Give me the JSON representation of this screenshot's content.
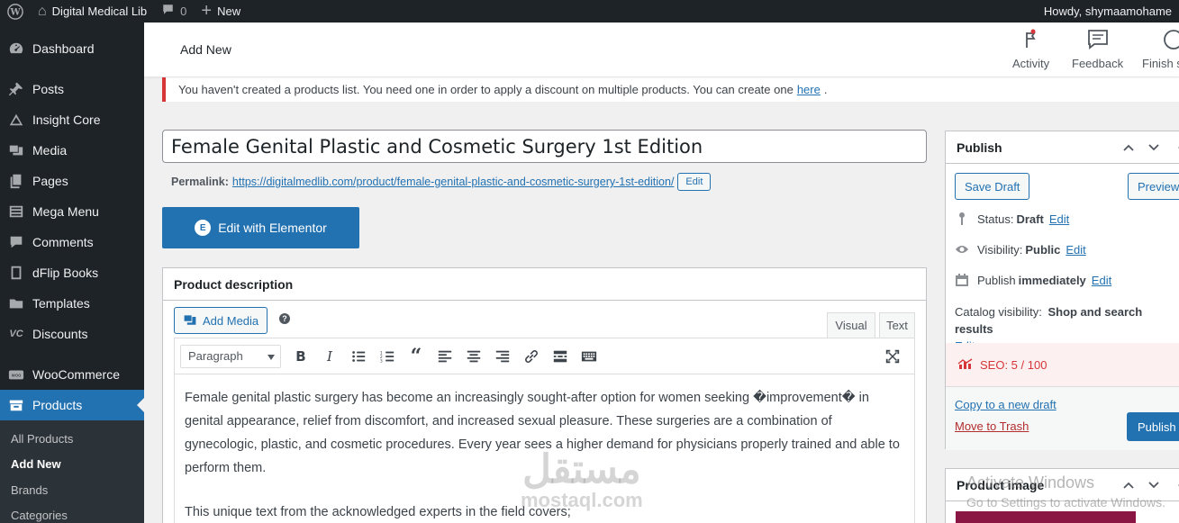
{
  "admin_bar": {
    "site_name": "Digital Medical Lib",
    "comments_count": "0",
    "new_label": "New",
    "howdy": "Howdy, shymaamohame"
  },
  "sidebar": {
    "items": [
      {
        "label": "Dashboard",
        "icon": "dashboard-icon"
      },
      {
        "label": "Posts",
        "icon": "pin-icon"
      },
      {
        "label": "Insight Core",
        "icon": "insight-icon"
      },
      {
        "label": "Media",
        "icon": "media-icon"
      },
      {
        "label": "Pages",
        "icon": "pages-icon"
      },
      {
        "label": "Mega Menu",
        "icon": "menu-icon"
      },
      {
        "label": "Comments",
        "icon": "comment-icon"
      },
      {
        "label": "dFlip Books",
        "icon": "book-icon"
      },
      {
        "label": "Templates",
        "icon": "folder-icon"
      },
      {
        "label": "Discounts",
        "icon": "discount-icon"
      },
      {
        "label": "WooCommerce",
        "icon": "woo-icon"
      },
      {
        "label": "Products",
        "icon": "archive-icon"
      }
    ],
    "submenu": [
      "All Products",
      "Add New",
      "Brands",
      "Categories"
    ]
  },
  "header": {
    "title": "Add New",
    "buttons": [
      {
        "label": "Activity",
        "icon": "flag-icon"
      },
      {
        "label": "Feedback",
        "icon": "feedback-icon"
      },
      {
        "label": "Finish s",
        "icon": "circle-icon"
      }
    ]
  },
  "notice": {
    "text": "You haven't created a products list. You need one in order to apply a discount on multiple products. You can create one",
    "link": "here",
    "suffix": "."
  },
  "editor": {
    "title": "Female Genital Plastic and Cosmetic Surgery 1st Edition",
    "permalink_label": "Permalink:",
    "permalink_base": "https://digitalmedlib.com/product/",
    "permalink_slug": "female-genital-plastic-and-cosmetic-surgery-1st-edition/",
    "permalink_edit": "Edit",
    "elementor_btn": "Edit with Elementor",
    "description_title": "Product description",
    "add_media": "Add Media",
    "tab_visual": "Visual",
    "tab_text": "Text",
    "format_select": "Paragraph",
    "paragraphs": [
      "Female genital plastic surgery has become an increasingly sought-after option for women seeking �improvement� in genital appearance, relief from discomfort, and increased sexual pleasure. These surgeries are a combination of gynecologic, plastic, and cosmetic procedures. Every year sees a higher demand for physicians properly trained and able to perform them.",
      "This unique text from the acknowledged experts in the field covers;"
    ]
  },
  "publish": {
    "title": "Publish",
    "save_draft": "Save Draft",
    "preview": "Preview",
    "status_label": "Status:",
    "status_value": "Draft",
    "visibility_label": "Visibility:",
    "visibility_value": "Public",
    "publish_label": "Publish",
    "publish_value": "immediately",
    "edit": "Edit",
    "catalog_label": "Catalog visibility:",
    "catalog_value": "Shop and search results",
    "seo": "SEO: 5 / 100",
    "copy_draft": "Copy to a new draft",
    "move_trash": "Move to Trash",
    "publish_btn": "Publish"
  },
  "product_image": {
    "title": "Product image"
  },
  "watermarks": {
    "activate_line1": "Activate Windows",
    "activate_line2": "Go to Settings to activate Windows.",
    "mostaql": "مستقل",
    "mostaql_sub": "mostaql.com"
  }
}
